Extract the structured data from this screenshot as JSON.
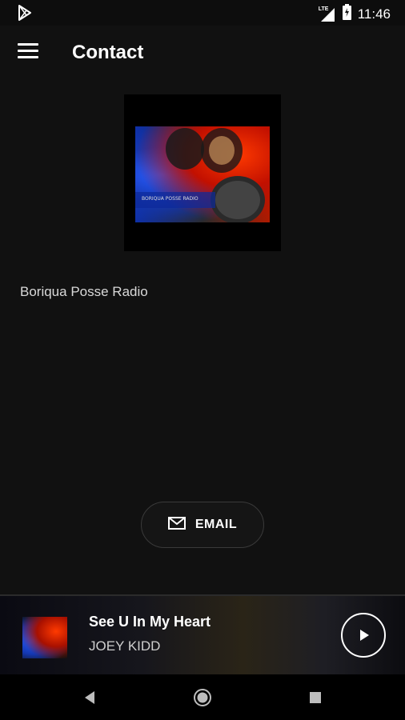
{
  "status_bar": {
    "network": "LTE",
    "time": "11:46",
    "icons": [
      "play-store-icon",
      "signal-icon",
      "battery-icon"
    ]
  },
  "app_bar": {
    "title": "Contact",
    "menu_icon": "hamburger-menu-icon"
  },
  "content": {
    "logo_text": "BORIQUA POSSE RADIO",
    "station_name": "Boriqua Posse Radio",
    "email_button": {
      "label": "EMAIL",
      "icon": "mail-icon"
    }
  },
  "player": {
    "song_title": "See U In My Heart",
    "artist": "JOEY KIDD",
    "play_icon": "play-icon"
  },
  "nav_bar": {
    "buttons": [
      "back-icon",
      "home-icon",
      "recents-icon"
    ]
  },
  "colors": {
    "background": "#111111",
    "text_primary": "#ffffff",
    "text_secondary": "#d9d9d9"
  }
}
